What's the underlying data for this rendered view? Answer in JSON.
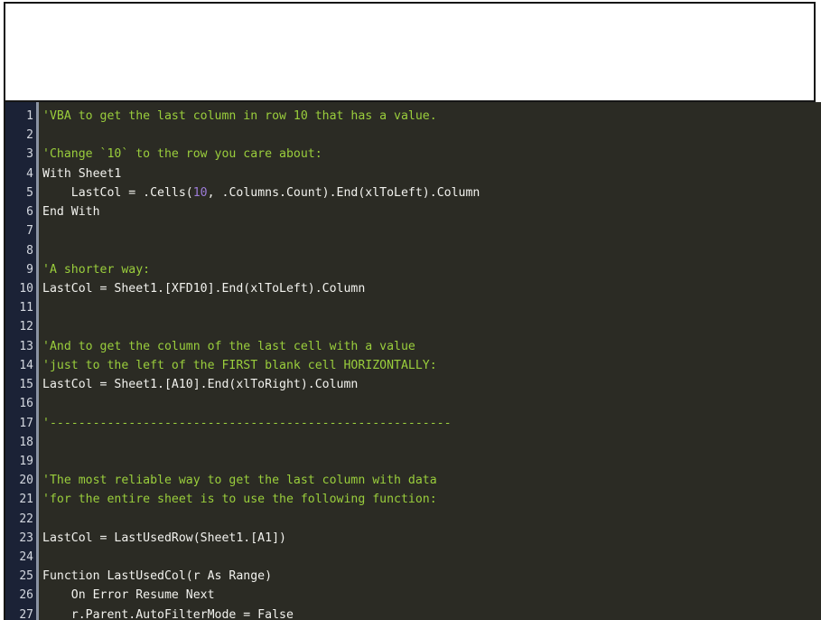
{
  "document": {
    "background_color": "#ffffff",
    "border_color": "#161616"
  },
  "code_block": {
    "language": "vba",
    "theme": {
      "background": "#2b2b24",
      "gutter_background": "#1b2236",
      "gutter_separator": "#8a93a3",
      "line_number_color": "#d4d8e0",
      "comment_color": "#9ace3c",
      "number_literal_color": "#9d7cd8",
      "code_color": "#f2f2ee"
    },
    "first_visible_line": 1,
    "last_visible_line": 27,
    "line_numbers": [
      1,
      2,
      3,
      4,
      5,
      6,
      7,
      8,
      9,
      10,
      11,
      12,
      13,
      14,
      15,
      16,
      17,
      18,
      19,
      20,
      21,
      22,
      23,
      24,
      25,
      26,
      27
    ],
    "lines": [
      {
        "n": 1,
        "tokens": [
          {
            "t": "cmt",
            "v": "'VBA to get the last column in row 10 that has a value."
          }
        ]
      },
      {
        "n": 2,
        "tokens": []
      },
      {
        "n": 3,
        "tokens": [
          {
            "t": "cmt",
            "v": "'Change `10` to the row you care about:"
          }
        ]
      },
      {
        "n": 4,
        "tokens": [
          {
            "t": "code",
            "v": "With Sheet1"
          }
        ]
      },
      {
        "n": 5,
        "tokens": [
          {
            "t": "code",
            "v": "    LastCol = .Cells("
          },
          {
            "t": "num",
            "v": "10"
          },
          {
            "t": "code",
            "v": ", .Columns.Count).End(xlToLeft).Column"
          }
        ]
      },
      {
        "n": 6,
        "tokens": [
          {
            "t": "code",
            "v": "End With"
          }
        ]
      },
      {
        "n": 7,
        "tokens": []
      },
      {
        "n": 8,
        "tokens": []
      },
      {
        "n": 9,
        "tokens": [
          {
            "t": "cmt",
            "v": "'A shorter way:"
          }
        ]
      },
      {
        "n": 10,
        "tokens": [
          {
            "t": "code",
            "v": "LastCol = Sheet1.[XFD10].End(xlToLeft).Column"
          }
        ]
      },
      {
        "n": 11,
        "tokens": []
      },
      {
        "n": 12,
        "tokens": []
      },
      {
        "n": 13,
        "tokens": [
          {
            "t": "cmt",
            "v": "'And to get the column of the last cell with a value"
          }
        ]
      },
      {
        "n": 14,
        "tokens": [
          {
            "t": "cmt",
            "v": "'just to the left of the FIRST blank cell HORIZONTALLY:"
          }
        ]
      },
      {
        "n": 15,
        "tokens": [
          {
            "t": "code",
            "v": "LastCol = Sheet1.[A10].End(xlToRight).Column"
          }
        ]
      },
      {
        "n": 16,
        "tokens": []
      },
      {
        "n": 17,
        "tokens": [
          {
            "t": "cmt",
            "v": "'--------------------------------------------------------"
          }
        ]
      },
      {
        "n": 18,
        "tokens": []
      },
      {
        "n": 19,
        "tokens": []
      },
      {
        "n": 20,
        "tokens": [
          {
            "t": "cmt",
            "v": "'The most reliable way to get the last column with data"
          }
        ]
      },
      {
        "n": 21,
        "tokens": [
          {
            "t": "cmt",
            "v": "'for the entire sheet is to use the following function:"
          }
        ]
      },
      {
        "n": 22,
        "tokens": []
      },
      {
        "n": 23,
        "tokens": [
          {
            "t": "code",
            "v": "LastCol = LastUsedRow(Sheet1.[A1])"
          }
        ]
      },
      {
        "n": 24,
        "tokens": []
      },
      {
        "n": 25,
        "tokens": [
          {
            "t": "code",
            "v": "Function LastUsedCol(r As Range)"
          }
        ]
      },
      {
        "n": 26,
        "tokens": [
          {
            "t": "code",
            "v": "    On Error Resume Next"
          }
        ]
      },
      {
        "n": 27,
        "tokens": [
          {
            "t": "code",
            "v": "    r.Parent.AutoFilterMode = False"
          }
        ]
      }
    ]
  }
}
